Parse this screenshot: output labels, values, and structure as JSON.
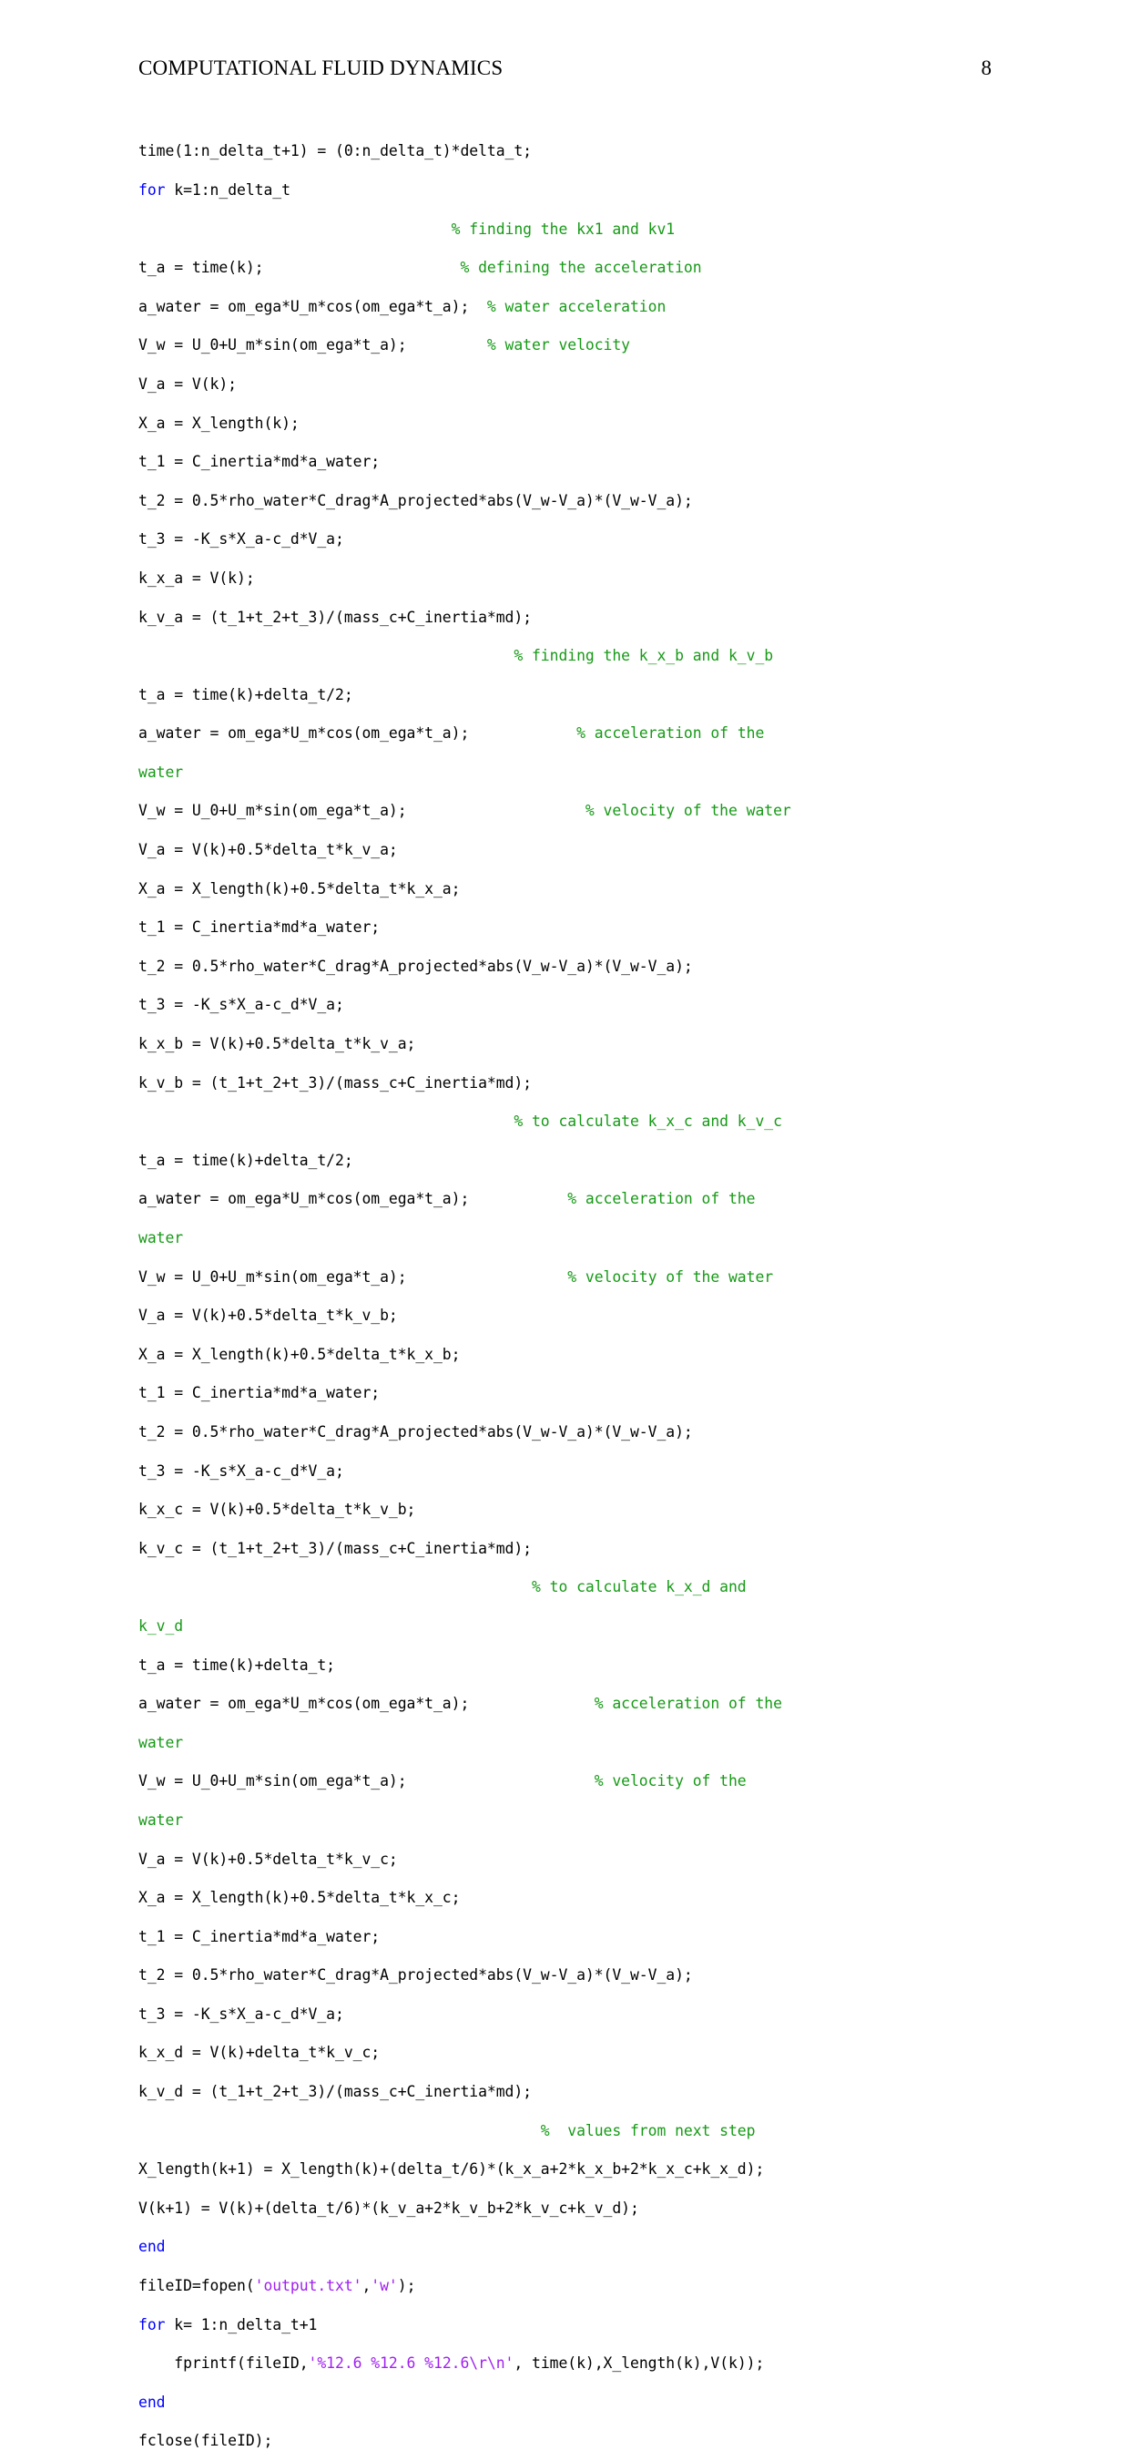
{
  "header": {
    "title": "COMPUTATIONAL FLUID DYNAMICS",
    "page_number": "8"
  },
  "colors": {
    "keyword": "#0000ff",
    "comment": "#179a17",
    "string": "#a020f0",
    "text": "#000000",
    "background": "#ffffff"
  },
  "code": {
    "language": "matlab",
    "lines": [
      {
        "segments": [
          {
            "t": "plain",
            "s": "time(1:n_delta_t+1) = (0:n_delta_t)*delta_t;"
          }
        ]
      },
      {
        "segments": [
          {
            "t": "kw",
            "s": "for"
          },
          {
            "t": "plain",
            "s": " k=1:n_delta_t"
          }
        ]
      },
      {
        "segments": [
          {
            "t": "cmt",
            "s": "                                   % finding the kx1 and kv1"
          }
        ]
      },
      {
        "segments": [
          {
            "t": "plain",
            "s": "t_a = time(k);                      "
          },
          {
            "t": "cmt",
            "s": "% defining the acceleration"
          }
        ]
      },
      {
        "segments": [
          {
            "t": "plain",
            "s": "a_water = om_ega*U_m*cos(om_ega*t_a);  "
          },
          {
            "t": "cmt",
            "s": "% water acceleration"
          }
        ]
      },
      {
        "segments": [
          {
            "t": "plain",
            "s": "V_w = U_0+U_m*sin(om_ega*t_a);         "
          },
          {
            "t": "cmt",
            "s": "% water velocity"
          }
        ]
      },
      {
        "segments": [
          {
            "t": "plain",
            "s": "V_a = V(k);"
          }
        ]
      },
      {
        "segments": [
          {
            "t": "plain",
            "s": "X_a = X_length(k);"
          }
        ]
      },
      {
        "segments": [
          {
            "t": "plain",
            "s": "t_1 = C_inertia*md*a_water;"
          }
        ]
      },
      {
        "segments": [
          {
            "t": "plain",
            "s": "t_2 = 0.5*rho_water*C_drag*A_projected*abs(V_w-V_a)*(V_w-V_a);"
          }
        ]
      },
      {
        "segments": [
          {
            "t": "plain",
            "s": "t_3 = -K_s*X_a-c_d*V_a;"
          }
        ]
      },
      {
        "segments": [
          {
            "t": "plain",
            "s": "k_x_a = V(k);"
          }
        ]
      },
      {
        "segments": [
          {
            "t": "plain",
            "s": "k_v_a = (t_1+t_2+t_3)/(mass_c+C_inertia*md);"
          }
        ]
      },
      {
        "segments": [
          {
            "t": "cmt",
            "s": "                                          % finding the k_x_b and k_v_b"
          }
        ]
      },
      {
        "segments": [
          {
            "t": "plain",
            "s": "t_a = time(k)+delta_t/2;"
          }
        ]
      },
      {
        "segments": [
          {
            "t": "plain",
            "s": "a_water = om_ega*U_m*cos(om_ega*t_a);            "
          },
          {
            "t": "cmt",
            "s": "% acceleration of the"
          }
        ]
      },
      {
        "segments": [
          {
            "t": "cmt",
            "s": "water"
          }
        ]
      },
      {
        "segments": [
          {
            "t": "plain",
            "s": "V_w = U_0+U_m*sin(om_ega*t_a);                    "
          },
          {
            "t": "cmt",
            "s": "% velocity of the water"
          }
        ]
      },
      {
        "segments": [
          {
            "t": "plain",
            "s": "V_a = V(k)+0.5*delta_t*k_v_a;"
          }
        ]
      },
      {
        "segments": [
          {
            "t": "plain",
            "s": "X_a = X_length(k)+0.5*delta_t*k_x_a;"
          }
        ]
      },
      {
        "segments": [
          {
            "t": "plain",
            "s": "t_1 = C_inertia*md*a_water;"
          }
        ]
      },
      {
        "segments": [
          {
            "t": "plain",
            "s": "t_2 = 0.5*rho_water*C_drag*A_projected*abs(V_w-V_a)*(V_w-V_a);"
          }
        ]
      },
      {
        "segments": [
          {
            "t": "plain",
            "s": "t_3 = -K_s*X_a-c_d*V_a;"
          }
        ]
      },
      {
        "segments": [
          {
            "t": "plain",
            "s": "k_x_b = V(k)+0.5*delta_t*k_v_a;"
          }
        ]
      },
      {
        "segments": [
          {
            "t": "plain",
            "s": "k_v_b = (t_1+t_2+t_3)/(mass_c+C_inertia*md);"
          }
        ]
      },
      {
        "segments": [
          {
            "t": "cmt",
            "s": "                                          % to calculate k_x_c and k_v_c"
          }
        ]
      },
      {
        "segments": [
          {
            "t": "plain",
            "s": "t_a = time(k)+delta_t/2;"
          }
        ]
      },
      {
        "segments": [
          {
            "t": "plain",
            "s": "a_water = om_ega*U_m*cos(om_ega*t_a);           "
          },
          {
            "t": "cmt",
            "s": "% acceleration of the"
          }
        ]
      },
      {
        "segments": [
          {
            "t": "cmt",
            "s": "water"
          }
        ]
      },
      {
        "segments": [
          {
            "t": "plain",
            "s": "V_w = U_0+U_m*sin(om_ega*t_a);                  "
          },
          {
            "t": "cmt",
            "s": "% velocity of the water"
          }
        ]
      },
      {
        "segments": [
          {
            "t": "plain",
            "s": "V_a = V(k)+0.5*delta_t*k_v_b;"
          }
        ]
      },
      {
        "segments": [
          {
            "t": "plain",
            "s": "X_a = X_length(k)+0.5*delta_t*k_x_b;"
          }
        ]
      },
      {
        "segments": [
          {
            "t": "plain",
            "s": "t_1 = C_inertia*md*a_water;"
          }
        ]
      },
      {
        "segments": [
          {
            "t": "plain",
            "s": "t_2 = 0.5*rho_water*C_drag*A_projected*abs(V_w-V_a)*(V_w-V_a);"
          }
        ]
      },
      {
        "segments": [
          {
            "t": "plain",
            "s": "t_3 = -K_s*X_a-c_d*V_a;"
          }
        ]
      },
      {
        "segments": [
          {
            "t": "plain",
            "s": "k_x_c = V(k)+0.5*delta_t*k_v_b;"
          }
        ]
      },
      {
        "segments": [
          {
            "t": "plain",
            "s": "k_v_c = (t_1+t_2+t_3)/(mass_c+C_inertia*md);"
          }
        ]
      },
      {
        "segments": [
          {
            "t": "cmt",
            "s": "                                            % to calculate k_x_d and"
          }
        ]
      },
      {
        "segments": [
          {
            "t": "cmt",
            "s": "k_v_d"
          }
        ]
      },
      {
        "segments": [
          {
            "t": "plain",
            "s": "t_a = time(k)+delta_t;"
          }
        ]
      },
      {
        "segments": [
          {
            "t": "plain",
            "s": "a_water = om_ega*U_m*cos(om_ega*t_a);              "
          },
          {
            "t": "cmt",
            "s": "% acceleration of the"
          }
        ]
      },
      {
        "segments": [
          {
            "t": "cmt",
            "s": "water"
          }
        ]
      },
      {
        "segments": [
          {
            "t": "plain",
            "s": "V_w = U_0+U_m*sin(om_ega*t_a);                     "
          },
          {
            "t": "cmt",
            "s": "% velocity of the"
          }
        ]
      },
      {
        "segments": [
          {
            "t": "cmt",
            "s": "water"
          }
        ]
      },
      {
        "segments": [
          {
            "t": "plain",
            "s": "V_a = V(k)+0.5*delta_t*k_v_c;"
          }
        ]
      },
      {
        "segments": [
          {
            "t": "plain",
            "s": "X_a = X_length(k)+0.5*delta_t*k_x_c;"
          }
        ]
      },
      {
        "segments": [
          {
            "t": "plain",
            "s": "t_1 = C_inertia*md*a_water;"
          }
        ]
      },
      {
        "segments": [
          {
            "t": "plain",
            "s": "t_2 = 0.5*rho_water*C_drag*A_projected*abs(V_w-V_a)*(V_w-V_a);"
          }
        ]
      },
      {
        "segments": [
          {
            "t": "plain",
            "s": "t_3 = -K_s*X_a-c_d*V_a;"
          }
        ]
      },
      {
        "segments": [
          {
            "t": "plain",
            "s": "k_x_d = V(k)+delta_t*k_v_c;"
          }
        ]
      },
      {
        "segments": [
          {
            "t": "plain",
            "s": "k_v_d = (t_1+t_2+t_3)/(mass_c+C_inertia*md);"
          }
        ]
      },
      {
        "segments": [
          {
            "t": "cmt",
            "s": "                                             %  values from next step"
          }
        ]
      },
      {
        "segments": [
          {
            "t": "plain",
            "s": "X_length(k+1) = X_length(k)+(delta_t/6)*(k_x_a+2*k_x_b+2*k_x_c+k_x_d);"
          }
        ]
      },
      {
        "segments": [
          {
            "t": "plain",
            "s": "V(k+1) = V(k)+(delta_t/6)*(k_v_a+2*k_v_b+2*k_v_c+k_v_d);"
          }
        ]
      },
      {
        "segments": [
          {
            "t": "kw",
            "s": "end"
          }
        ]
      },
      {
        "segments": [
          {
            "t": "plain",
            "s": "fileID=fopen("
          },
          {
            "t": "str",
            "s": "'output.txt'"
          },
          {
            "t": "plain",
            "s": ","
          },
          {
            "t": "str",
            "s": "'w'"
          },
          {
            "t": "plain",
            "s": ");"
          }
        ]
      },
      {
        "segments": [
          {
            "t": "kw",
            "s": "for"
          },
          {
            "t": "plain",
            "s": " k= 1:n_delta_t+1"
          }
        ]
      },
      {
        "segments": [
          {
            "t": "plain",
            "s": "    fprintf(fileID,"
          },
          {
            "t": "str",
            "s": "'%12.6 %12.6 %12.6\\r\\n'"
          },
          {
            "t": "plain",
            "s": ", time(k),X_length(k),V(k));"
          }
        ]
      },
      {
        "segments": [
          {
            "t": "kw",
            "s": "end"
          }
        ]
      },
      {
        "segments": [
          {
            "t": "plain",
            "s": "fclose(fileID);"
          }
        ]
      }
    ]
  }
}
